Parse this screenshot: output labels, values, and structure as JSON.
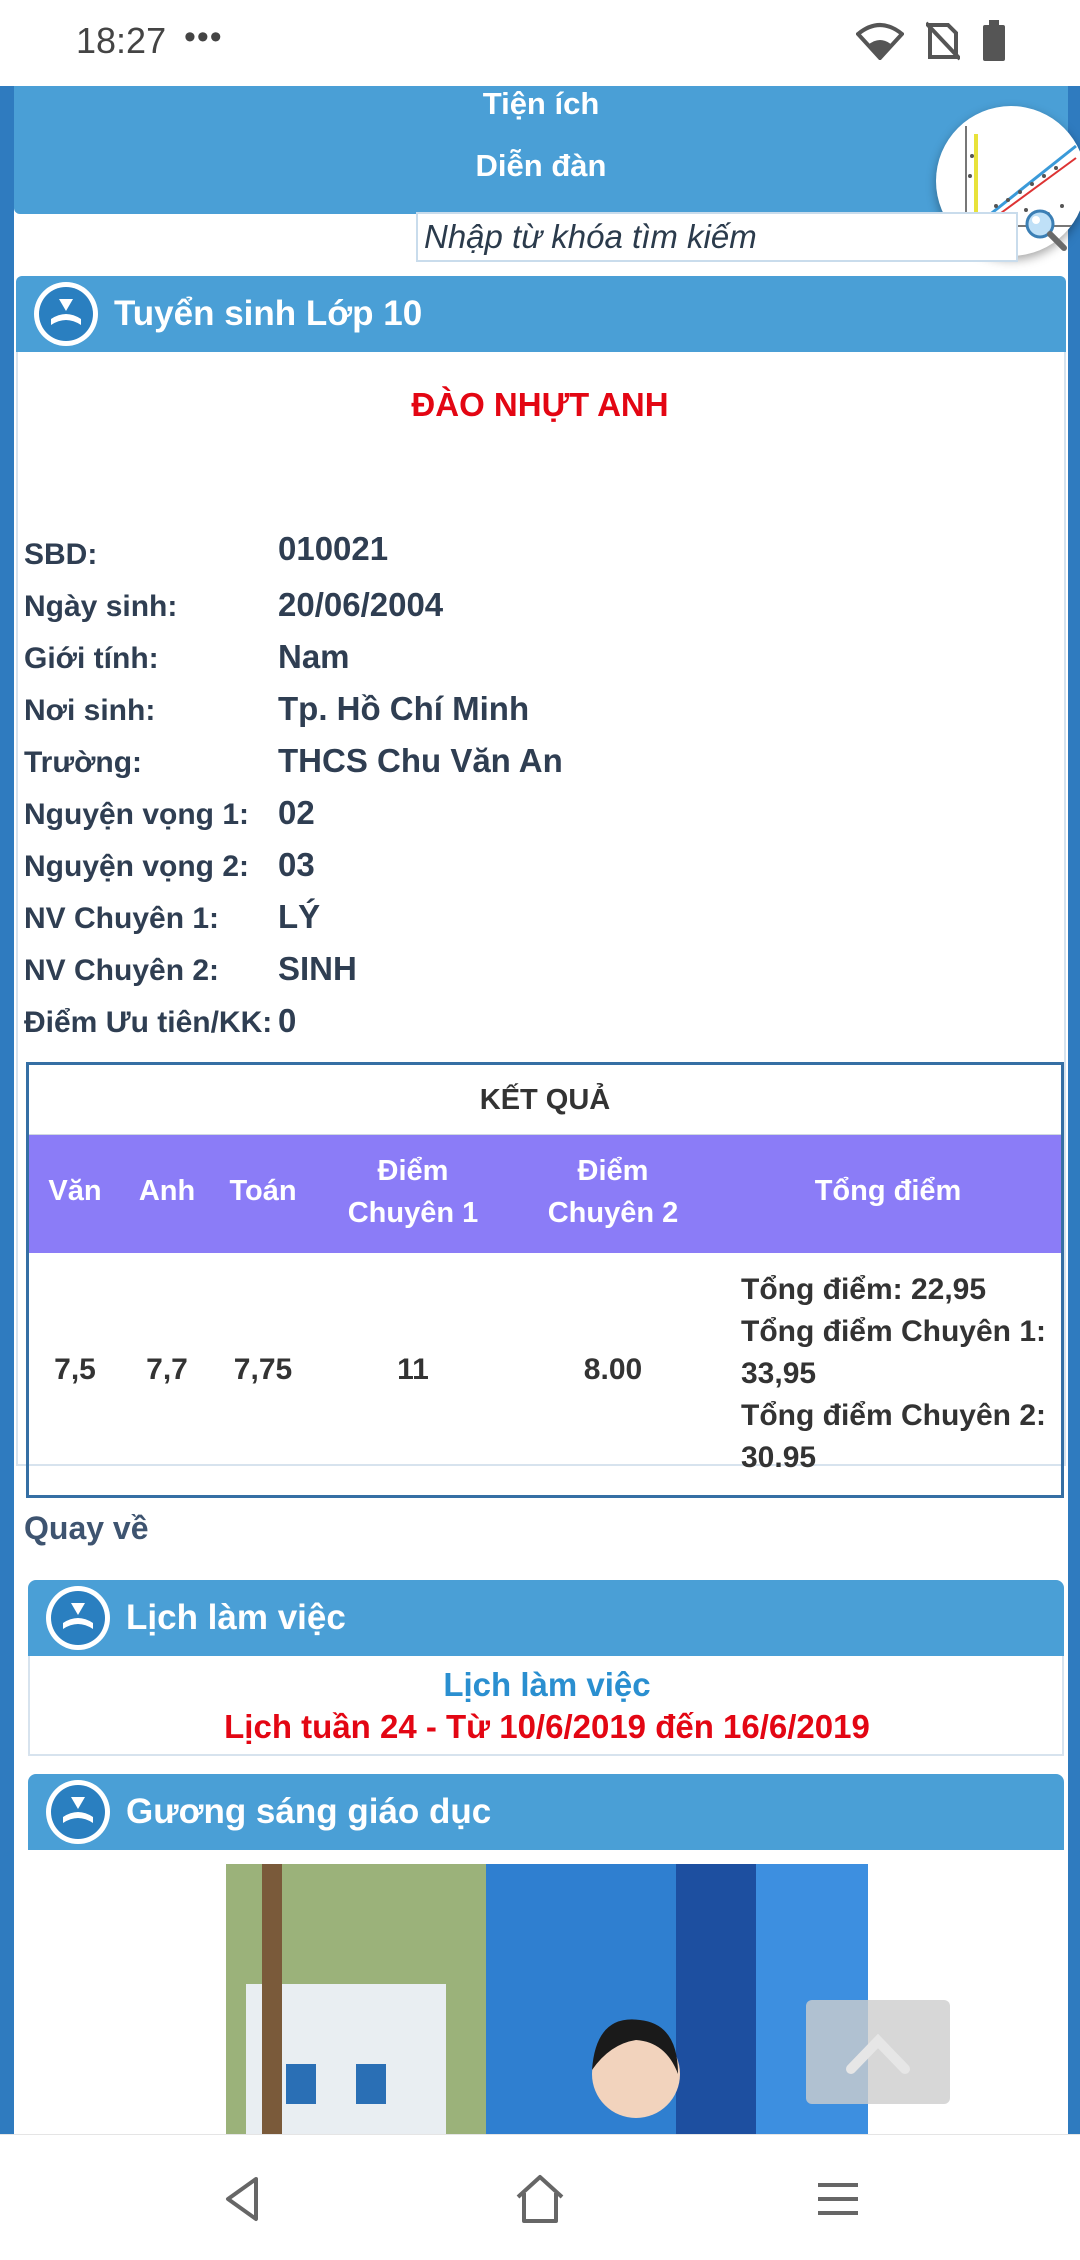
{
  "status_bar": {
    "time": "18:27",
    "more": "•••"
  },
  "top_menu": {
    "items": [
      "Tiện ích",
      "Diễn đàn"
    ]
  },
  "search": {
    "placeholder": "Nhập từ khóa tìm kiếm"
  },
  "tuyen_sinh": {
    "header": "Tuyển sinh Lớp 10",
    "student_name": "ĐÀO NHỰT ANH",
    "fields": [
      {
        "label": "SBD:",
        "value": "010021"
      },
      {
        "label": "Ngày sinh:",
        "value": "20/06/2004"
      },
      {
        "label": "Giới tính:",
        "value": "Nam"
      },
      {
        "label": "Nơi sinh:",
        "value": "Tp. Hồ Chí Minh"
      },
      {
        "label": "Trường:",
        "value": "THCS Chu Văn An"
      },
      {
        "label": "Nguyện vọng 1:",
        "value": "02"
      },
      {
        "label": "Nguyện vọng 2:",
        "value": "03"
      },
      {
        "label": "NV Chuyên 1:",
        "value": "LÝ"
      },
      {
        "label": "NV Chuyên 2:",
        "value": "SINH"
      },
      {
        "label": "Điểm Ưu tiên/KK:",
        "value": "0"
      }
    ],
    "results": {
      "title": "KẾT QUẢ",
      "headers": [
        "Văn",
        "Anh",
        "Toán",
        "Điểm",
        "Chuyên 1",
        "Điểm",
        "Chuyên 2",
        "Tổng điểm"
      ],
      "values": [
        "7,5",
        "7,7",
        "7,75",
        "11",
        "8.00"
      ],
      "total_lines": [
        "Tổng điểm: 22,95",
        "Tổng điểm Chuyên 1:",
        "33,95",
        "Tổng điểm Chuyên 2:",
        "30.95"
      ]
    },
    "back_link": "Quay về"
  },
  "lich_lam_viec": {
    "header": "Lịch làm việc",
    "title": "Lịch làm việc",
    "subtitle": "Lịch tuần 24 - Từ 10/6/2019 đến 16/6/2019"
  },
  "guong_sang": {
    "header": "Gương sáng giáo dục"
  },
  "colors": {
    "header_blue": "#4a9fd6",
    "table_header": "#8b7cf7",
    "accent_red": "#e30613",
    "link_blue": "#2a8fd0"
  }
}
